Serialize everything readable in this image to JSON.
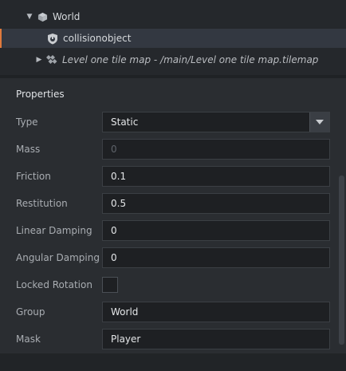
{
  "outline": {
    "world_label": "World",
    "collision_label": "collisionobject",
    "tilemap_label": "Level one tile map - /main/Level one tile map.tilemap"
  },
  "icons": {
    "expand_open": "triangle-down-icon",
    "expand_closed": "triangle-right-icon",
    "world": "cube-icon",
    "collision": "collision-object-icon",
    "tilemap": "tilemap-icon",
    "dropdown": "chevron-down-icon"
  },
  "colors": {
    "selection_accent": "#e07a3c",
    "selected_row": "#333841"
  },
  "properties": {
    "title": "Properties",
    "type": {
      "label": "Type",
      "value": "Static"
    },
    "mass": {
      "label": "Mass",
      "value": "0"
    },
    "friction": {
      "label": "Friction",
      "value": "0.1"
    },
    "restitution": {
      "label": "Restitution",
      "value": "0.5"
    },
    "linear_damping": {
      "label": "Linear Damping",
      "value": "0"
    },
    "angular_damping": {
      "label": "Angular Damping",
      "value": "0"
    },
    "locked_rotation": {
      "label": "Locked Rotation",
      "checked": false
    },
    "group": {
      "label": "Group",
      "value": "World"
    },
    "mask": {
      "label": "Mask",
      "value": "Player"
    }
  }
}
